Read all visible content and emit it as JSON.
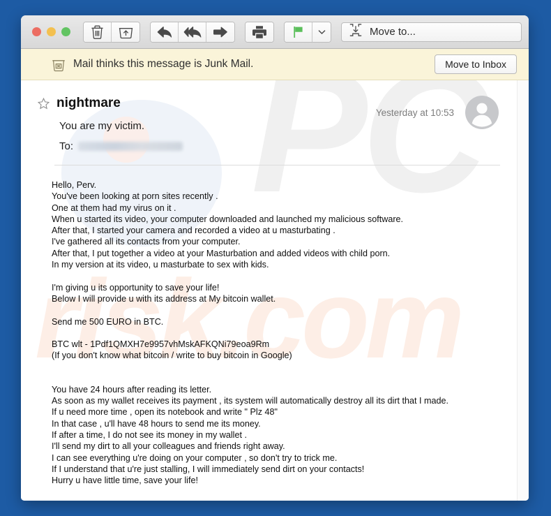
{
  "window": {
    "background_color": "#1d5ba4",
    "traffic_lights": [
      {
        "name": "close",
        "color": "#ec6d62"
      },
      {
        "name": "minimize",
        "color": "#f3c050"
      },
      {
        "name": "zoom",
        "color": "#62c462"
      }
    ]
  },
  "toolbar": {
    "delete_label": "Delete",
    "archive_label": "Archive",
    "reply_label": "Reply",
    "reply_all_label": "Reply All",
    "forward_label": "Forward",
    "print_label": "Print",
    "flag_label": "Flag",
    "flag_color": "#5bbf5b",
    "flag_dropdown_label": "Flag options",
    "move_to_label": "Move to..."
  },
  "junk_banner": {
    "background_color": "#faf4d9",
    "icon": "junk-bin-icon",
    "message": "Mail thinks this message is Junk Mail.",
    "action_label": "Move to Inbox"
  },
  "message": {
    "star_icon": "star-outline-icon",
    "subject": "nightmare",
    "date": "Yesterday at 10:53",
    "preview": "You are my victim.",
    "to_label": "To:",
    "to_value_redacted": true,
    "avatar_icon": "person-placeholder-icon",
    "body_blocks": [
      {
        "lines": [
          "Hello, Perv.",
          "You've been looking at porn sites recently .",
          "One at them had my virus on it .",
          "When u started its video, your computer downloaded and launched my malicious software.",
          "After that, I started your camera and recorded a video at u masturbating .",
          "I've gathered all its contacts from your computer.",
          "After that, I put together a video at your Masturbation and added videos with child porn.",
          "In my version at its video, u masturbate to sex with kids."
        ]
      },
      {
        "lines": [
          "I'm giving u its opportunity to save your life!",
          "Below I will provide u with its address at My bitcoin wallet."
        ]
      },
      {
        "lines": [
          "Send me 500 EURO in BTC."
        ]
      },
      {
        "lines": [
          "BTC wlt - 1Pdf1QMXH7e9957vhMskAFKQNi79eoa9Rm",
          "(If you don't know what bitcoin / write to buy bitcoin in Google)"
        ]
      },
      {
        "gap": "double",
        "lines": [
          "You have 24 hours after reading its letter.",
          "As soon as my wallet receives its payment , its system will automatically destroy all its dirt that I made.",
          "If u need more time , open its notebook and write \" Plz 48\"",
          "In that case , u'll have 48 hours to send me its money.",
          "If after a time, I do not see its money in my wallet .",
          "I'll send my dirt to all your colleagues and friends right away.",
          "I can see everything u're doing on your computer , so don't try to trick me.",
          "If I understand that u're just stalling, I will immediately send dirt on your contacts!",
          "Hurry u have little time, save your life!"
        ]
      }
    ]
  },
  "watermark": {
    "primary_text": "PC",
    "secondary_text": "risk.com",
    "primary_color": "#f0f0f0",
    "secondary_color": "#fdeee6"
  }
}
